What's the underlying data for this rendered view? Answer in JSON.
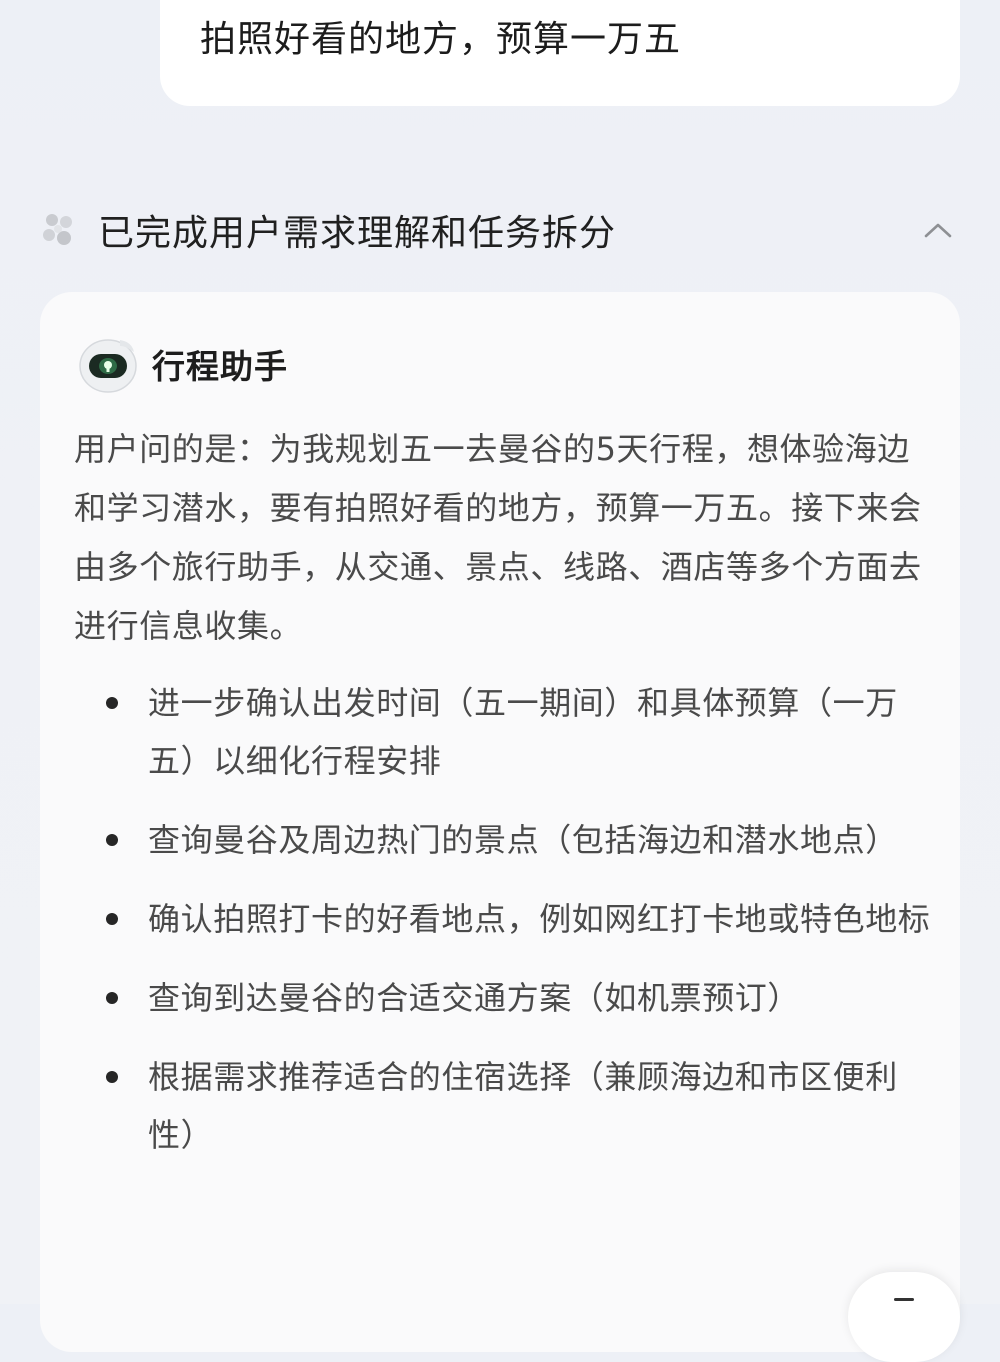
{
  "user_message": {
    "text": "拍照好看的地方，预算一万五"
  },
  "status": {
    "text": "已完成用户需求理解和任务拆分",
    "icon": "sparkle-cluster-icon",
    "collapse_icon": "chevron-up-icon"
  },
  "agent": {
    "name": "行程助手",
    "avatar_icon": "robot-avatar-icon",
    "summary": "用户问的是：为我规划五一去曼谷的5天行程，想体验海边和学习潜水，要有拍照好看的地方，预算一万五。接下来会由多个旅行助手，从交通、景点、线路、酒店等多个方面去进行信息收集。",
    "tasks": [
      "进一步确认出发时间（五一期间）和具体预算（一万五）以细化行程安排",
      "查询曼谷及周边热门的景点（包括海边和潜水地点）",
      "确认拍照打卡的好看地点，例如网红打卡地或特色地标",
      "查询到达曼谷的合适交通方案（如机票预订）",
      "根据需求推荐适合的住宿选择（兼顾海边和市区便利性）"
    ]
  },
  "colors": {
    "background": "#eef1f6",
    "card": "#fafafb",
    "bubble": "#ffffff",
    "body_text": "#4a4a4a",
    "heading_text": "#1d1d1d"
  }
}
